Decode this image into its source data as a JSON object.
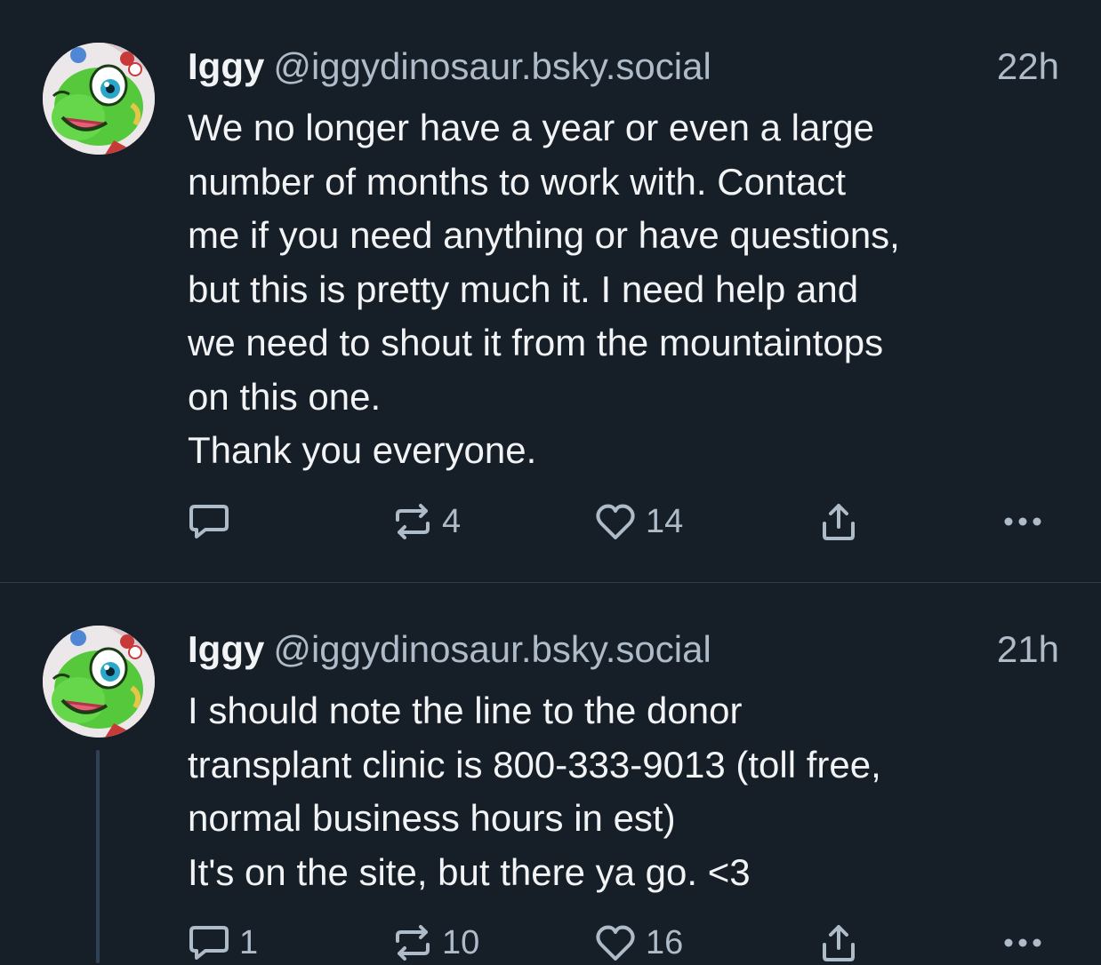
{
  "colors": {
    "background": "#161e27",
    "text_primary": "#f1f3f5",
    "text_secondary": "#aebbc9",
    "divider": "#2e3c4b",
    "thread_line": "#2f4154"
  },
  "posts": [
    {
      "author": {
        "name": "Iggy",
        "handle": "@iggydinosaur.bsky.social",
        "avatar_icon": "green-dinosaur-avatar"
      },
      "time": "22h",
      "body_lines": [
        "We no longer have a year or even a large",
        "number of months to work with.  Contact",
        "me if you need anything or have questions,",
        "but this is pretty much it.  I need help and",
        "we need to shout it from the mountaintops",
        "on this one.",
        "Thank you everyone."
      ],
      "actions": {
        "reply_icon": "reply-icon",
        "reply_count": "",
        "repost_icon": "repost-icon",
        "repost_count": "4",
        "like_icon": "heart-icon",
        "like_count": "14",
        "share_icon": "share-icon",
        "more_icon": "more-options-icon"
      }
    },
    {
      "author": {
        "name": "Iggy",
        "handle": "@iggydinosaur.bsky.social",
        "avatar_icon": "green-dinosaur-avatar"
      },
      "time": "21h",
      "body_lines": [
        "I should note the line to the donor",
        "transplant clinic is 800-333-9013 (toll free,",
        "normal business hours in est)",
        "It's on the site, but there ya go. <3"
      ],
      "actions": {
        "reply_icon": "reply-icon",
        "reply_count": "1",
        "repost_icon": "repost-icon",
        "repost_count": "10",
        "like_icon": "heart-icon",
        "like_count": "16",
        "share_icon": "share-icon",
        "more_icon": "more-options-icon"
      }
    }
  ]
}
